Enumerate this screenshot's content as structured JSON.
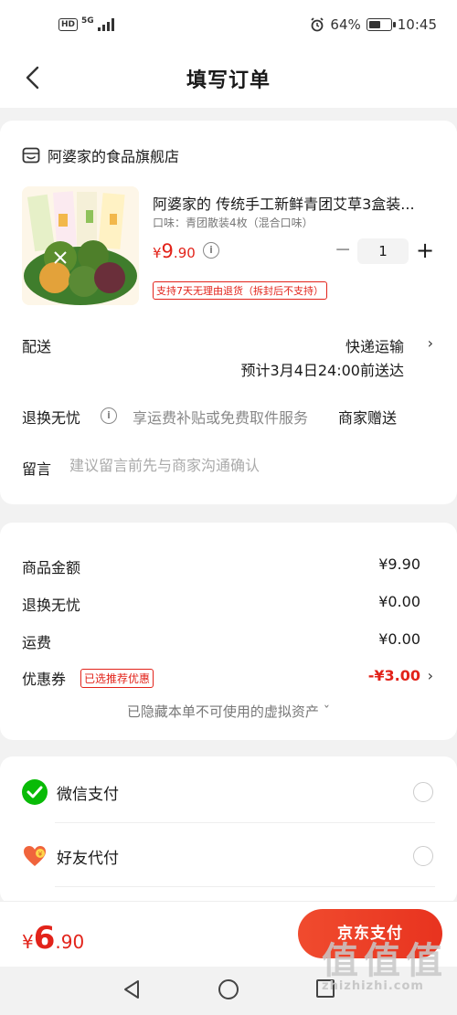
{
  "status_bar": {
    "network": "5G",
    "hd": "HD",
    "battery_pct": "64%",
    "battery_level": 0.64,
    "time": "10:45"
  },
  "header": {
    "title": "填写订单"
  },
  "order": {
    "shop_name": "阿婆家的食品旗舰店",
    "product": {
      "title": "阿婆家的 传统手工新鲜青团艾草3盒装...",
      "spec": "口味：青团散装4枚（混合口味）",
      "price_symbol": "¥",
      "price_int": "9",
      "price_dec": ".90",
      "quantity": "1",
      "minus": "−",
      "plus": "+",
      "return_policy": "支持7天无理由退货（拆封后不支持）"
    },
    "delivery": {
      "label": "配送",
      "method": "快递运输",
      "eta": "预计3月4日24:00前送达"
    },
    "return_service": {
      "label": "退换无忧",
      "desc": "享运费补贴或免费取件服务",
      "value": "商家赠送"
    },
    "message": {
      "label": "留言",
      "placeholder": "建议留言前先与商家沟通确认"
    }
  },
  "summary": {
    "items": [
      {
        "label": "商品金额",
        "value": "¥9.90"
      },
      {
        "label": "退换无忧",
        "value": "¥0.00"
      },
      {
        "label": "运费",
        "value": "¥0.00"
      }
    ],
    "coupon": {
      "label": "优惠券",
      "tag": "已选推荐优惠",
      "value": "-¥3.00"
    },
    "hidden_assets": "已隐藏本单不可使用的虚拟资产 ˇ"
  },
  "payment": {
    "methods": [
      {
        "label": "微信支付",
        "icon": "wechat-pay-icon"
      },
      {
        "label": "好友代付",
        "icon": "friend-pay-icon"
      }
    ]
  },
  "footer": {
    "total_symbol": "¥",
    "total_int": "6",
    "total_dec": ".90",
    "pay_button": "京东支付"
  },
  "watermark": {
    "text": "值",
    "site": "zhizhizhi.com"
  },
  "colors": {
    "accent": "#e2231a",
    "wechat": "#09bb07",
    "friend_pay": "#f0643c"
  }
}
